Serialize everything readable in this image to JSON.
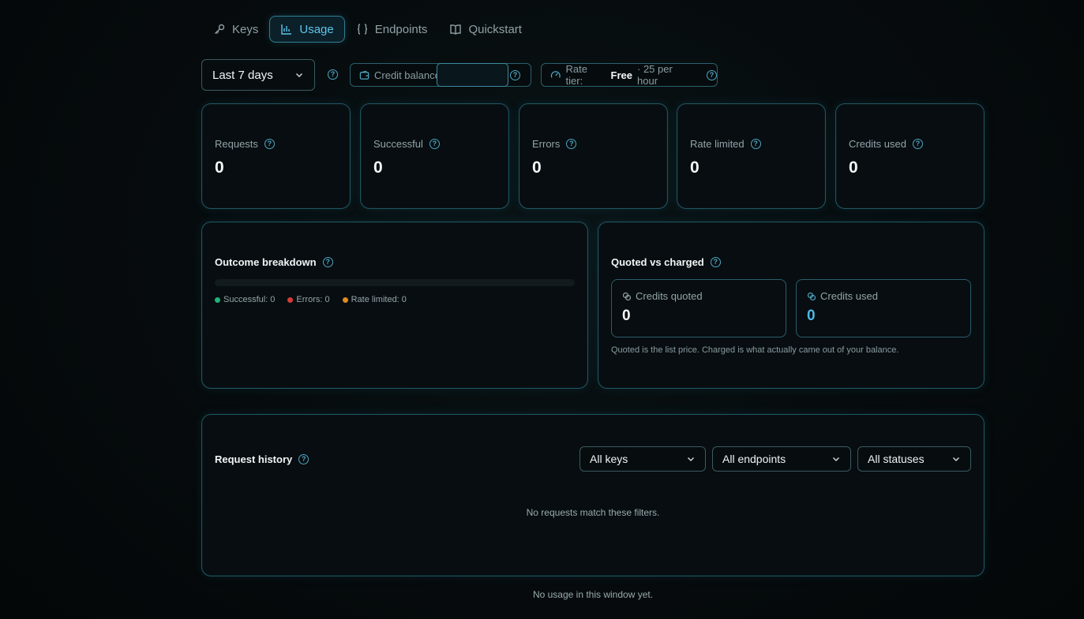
{
  "tabs": [
    {
      "label": "Keys",
      "icon": "key-icon",
      "active": false
    },
    {
      "label": "Usage",
      "icon": "bar-chart-icon",
      "active": true
    },
    {
      "label": "Endpoints",
      "icon": "braces-icon",
      "active": false
    },
    {
      "label": "Quickstart",
      "icon": "book-icon",
      "active": false
    }
  ],
  "filters": {
    "range": "Last 7 days",
    "credit_balance_label": "Credit balance",
    "credit_balance_value": "",
    "rate_tier_label": "Rate tier:",
    "rate_tier_name": "Free",
    "rate_tier_limit": "· 25 per hour"
  },
  "stats": [
    {
      "label": "Requests",
      "value": "0"
    },
    {
      "label": "Successful",
      "value": "0"
    },
    {
      "label": "Errors",
      "value": "0"
    },
    {
      "label": "Rate limited",
      "value": "0"
    },
    {
      "label": "Credits used",
      "value": "0"
    }
  ],
  "outcome": {
    "title": "Outcome breakdown",
    "legend": [
      {
        "label": "Successful: 0",
        "color": "#1fb27a"
      },
      {
        "label": "Errors: 0",
        "color": "#d83a3a"
      },
      {
        "label": "Rate limited: 0",
        "color": "#e08a1e"
      }
    ]
  },
  "quoted": {
    "title": "Quoted vs charged",
    "quoted_label": "Credits quoted",
    "quoted_value": "0",
    "used_label": "Credits used",
    "used_value": "0",
    "note": "Quoted is the list price. Charged is what actually came out of your balance."
  },
  "history": {
    "title": "Request history",
    "keys_filter": "All keys",
    "endpoints_filter": "All endpoints",
    "statuses_filter": "All statuses",
    "empty_message": "No requests match these filters."
  },
  "footer": "No usage in this window yet.",
  "colors": {
    "accent": "#5cc6ee",
    "border": "#1f5662",
    "background": "#05090b"
  }
}
